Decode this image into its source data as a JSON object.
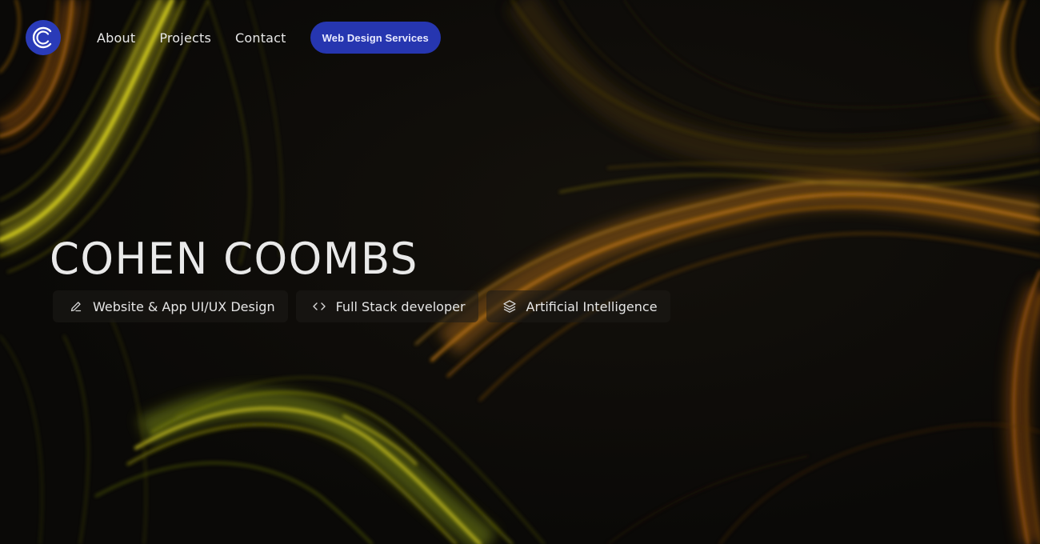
{
  "nav": {
    "logo_letter": "C",
    "links": [
      {
        "label": "About"
      },
      {
        "label": "Projects"
      },
      {
        "label": "Contact"
      }
    ],
    "cta_label": "Web Design Services"
  },
  "hero": {
    "title": "COHEN COOMBS",
    "tags": [
      {
        "icon": "pencil-icon",
        "label": "Website & App UI/UX Design"
      },
      {
        "icon": "code-icon",
        "label": "Full Stack developer"
      },
      {
        "icon": "layers-icon",
        "label": "Artificial Intelligence"
      }
    ]
  },
  "colors": {
    "background": "#0c0b09",
    "accent_blue": "#2636b0",
    "flow_yellow": "#c9c21a",
    "flow_orange": "#a8620f"
  }
}
